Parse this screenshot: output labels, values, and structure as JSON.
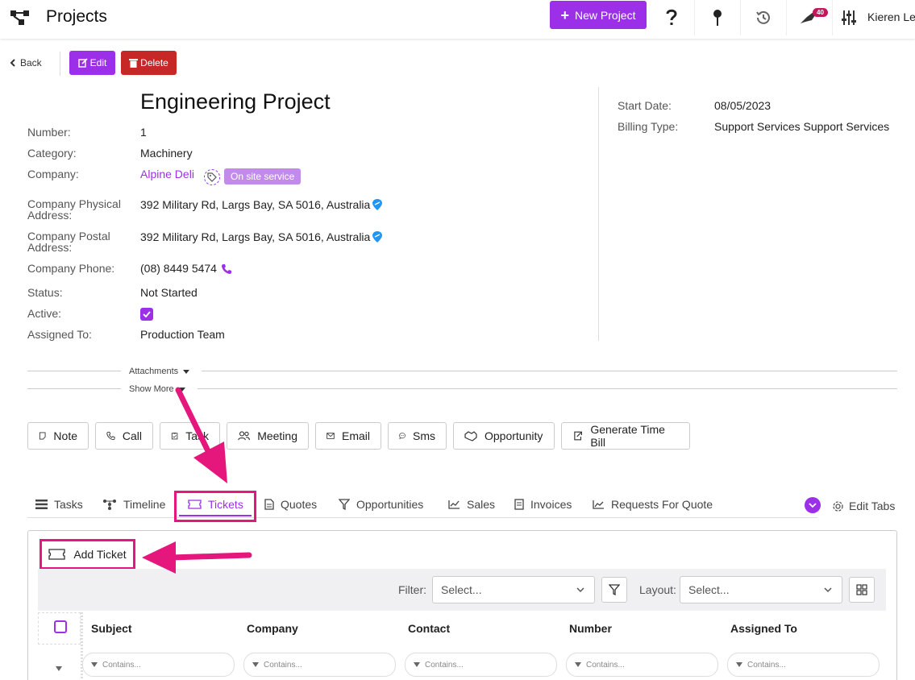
{
  "header": {
    "title": "Projects",
    "new_project_label": "New Project",
    "notification_count": "40",
    "user_name": "Kieren Le C"
  },
  "actions": {
    "back_label": "Back",
    "edit_label": "Edit",
    "delete_label": "Delete"
  },
  "project": {
    "title": "Engineering Project",
    "fields": {
      "number": {
        "label": "Number:",
        "value": "1"
      },
      "category": {
        "label": "Category:",
        "value": "Machinery"
      },
      "company": {
        "label": "Company:",
        "value": "Alpine Deli",
        "tag": "On site service"
      },
      "physical_address": {
        "label": "Company Physical Address:",
        "value": "392 Military Rd, Largs Bay, SA 5016, Australia"
      },
      "postal_address": {
        "label": "Company Postal Address:",
        "value": "392 Military Rd, Largs Bay, SA 5016, Australia"
      },
      "phone": {
        "label": "Company Phone:",
        "value": "(08) 8449 5474"
      },
      "status": {
        "label": "Status:",
        "value": "Not Started"
      },
      "active": {
        "label": "Active:",
        "checked": true
      },
      "assigned_to": {
        "label": "Assigned To:",
        "value": "Production Team"
      }
    },
    "right_fields": {
      "start_date": {
        "label": "Start Date:",
        "value": "08/05/2023"
      },
      "billing_type": {
        "label": "Billing Type:",
        "value": "Support Services Support Services"
      }
    }
  },
  "collapsibles": {
    "attachments": "Attachments",
    "show_more": "Show More"
  },
  "activity_buttons": [
    {
      "label": "Note",
      "icon": "note-icon"
    },
    {
      "label": "Call",
      "icon": "phone-icon"
    },
    {
      "label": "Task",
      "icon": "clipboard-icon"
    },
    {
      "label": "Meeting",
      "icon": "people-icon"
    },
    {
      "label": "Email",
      "icon": "envelope-icon"
    },
    {
      "label": "Sms",
      "icon": "chat-icon"
    },
    {
      "label": "Opportunity",
      "icon": "handshake-icon"
    },
    {
      "label": "Generate Time Bill",
      "icon": "export-icon"
    }
  ],
  "tabs": [
    {
      "label": "Tasks",
      "icon": "list-icon"
    },
    {
      "label": "Timeline",
      "icon": "timeline-icon"
    },
    {
      "label": "Tickets",
      "icon": "ticket-icon",
      "active": true
    },
    {
      "label": "Quotes",
      "icon": "document-icon"
    },
    {
      "label": "Opportunities",
      "icon": "filter-icon"
    },
    {
      "label": "Sales",
      "icon": "chart-icon"
    },
    {
      "label": "Invoices",
      "icon": "invoice-icon"
    },
    {
      "label": "Requests For Quote",
      "icon": "trend-icon"
    }
  ],
  "edit_tabs_label": "Edit Tabs",
  "tickets": {
    "add_label": "Add Ticket",
    "filter_label": "Filter:",
    "filter_placeholder": "Select...",
    "layout_label": "Layout:",
    "layout_placeholder": "Select...",
    "columns": [
      "Subject",
      "Company",
      "Contact",
      "Number",
      "Assigned To"
    ],
    "column_filter_placeholder": "Contains..."
  },
  "colors": {
    "accent": "#9b30e8",
    "danger": "#c62828",
    "highlight": "#e5177c",
    "tag": "#c28be9"
  }
}
